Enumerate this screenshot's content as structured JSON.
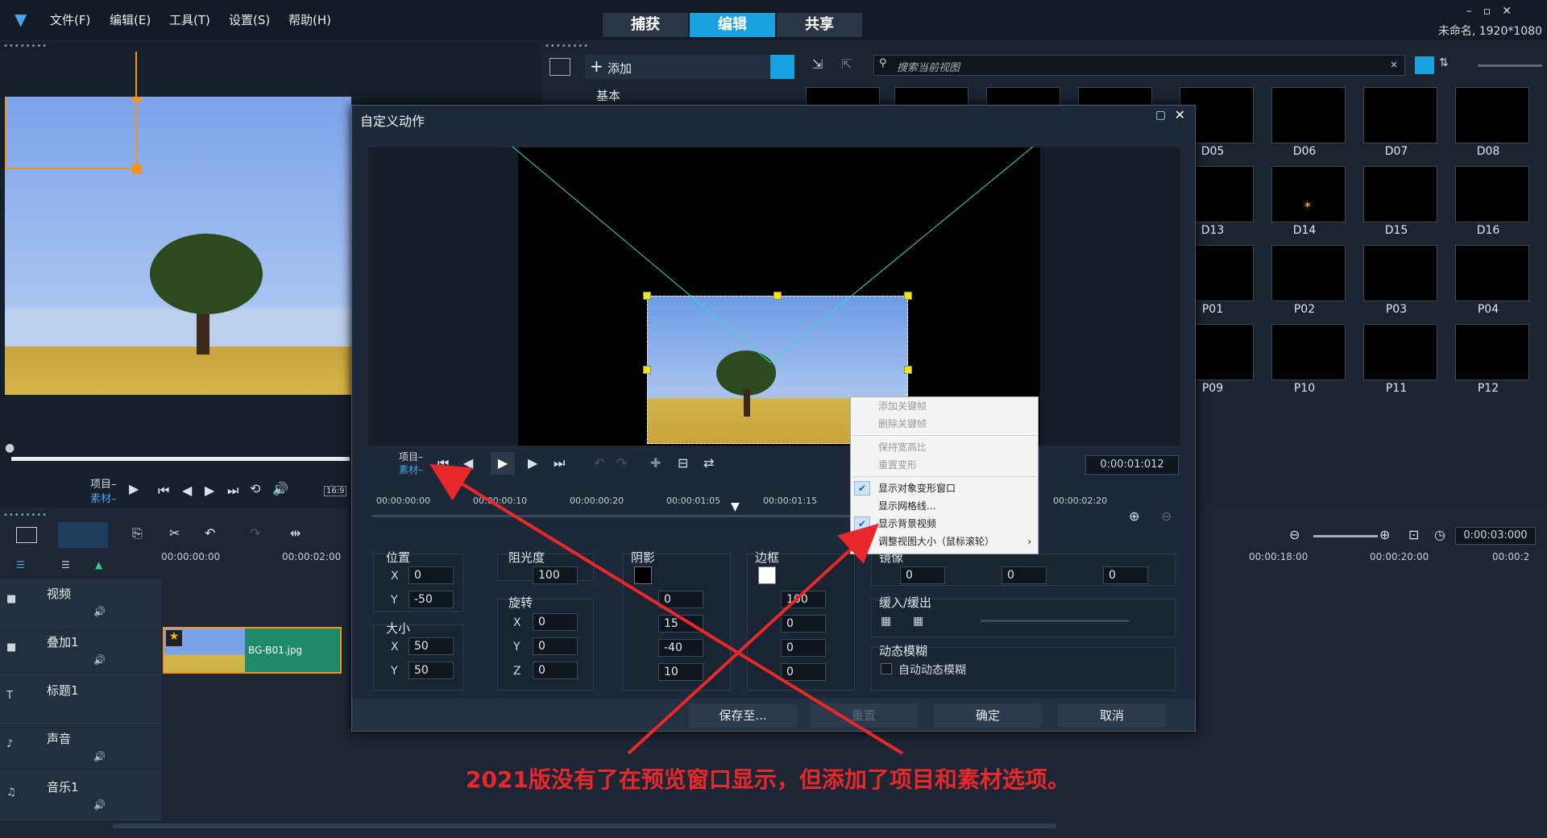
{
  "menu": [
    "文件(F)",
    "编辑(E)",
    "工具(T)",
    "设置(S)",
    "帮助(H)"
  ],
  "main_tabs": [
    "捕获",
    "编辑",
    "共享"
  ],
  "project_name": "未命名, 1920*1080",
  "preview": {
    "proj_label": "项目",
    "clip_label": "素材",
    "aspect": "16:9"
  },
  "library": {
    "add_label": "添加",
    "basic_label": "基本",
    "search_placeholder": "搜索当前视图",
    "thumbs": [
      {
        "row": 0,
        "items": [
          "",
          "",
          "",
          "",
          "D05",
          "D06",
          "D07",
          "D08"
        ]
      },
      {
        "row": 1,
        "items": [
          "D13",
          "D14",
          "D15",
          "D16"
        ]
      },
      {
        "row": 2,
        "items": [
          "P01",
          "P02",
          "P03",
          "P04"
        ]
      },
      {
        "row": 3,
        "items": [
          "P09",
          "P10",
          "P11",
          "P12"
        ]
      }
    ]
  },
  "timeline": {
    "ruler": [
      "00:00:00:00",
      "00:00:02:00",
      "00:00:18:00",
      "00:00:20:00",
      "00:00:2"
    ],
    "duration": "0:00:03:000",
    "tracks": [
      "视频",
      "叠加1",
      "标题1",
      "声音",
      "音乐1"
    ],
    "clip_name": "BG-B01.jpg"
  },
  "dialog": {
    "title": "自定义动作",
    "proj_label": "项目",
    "clip_label": "素材",
    "timecode": "0:00:01:012",
    "ruler": [
      "00:00:00:00",
      "00:00:00:10",
      "00:00:00:20",
      "00:00:01:05",
      "00:00:01:15",
      "00:00:02:20"
    ],
    "position": {
      "label": "位置",
      "x": "0",
      "y": "-50"
    },
    "size": {
      "label": "大小",
      "x": "50",
      "y": "50"
    },
    "opacity": {
      "label": "阻光度",
      "value": "100"
    },
    "rotation": {
      "label": "旋转",
      "x": "0",
      "y": "0",
      "z": "0"
    },
    "shadow": {
      "label": "阴影",
      "v1": "0",
      "v2": "15",
      "v3": "-40",
      "v4": "10"
    },
    "border": {
      "label": "边框",
      "v1": "100",
      "v2": "0",
      "v3": "0",
      "v4": "0"
    },
    "mirror": {
      "label": "镜像",
      "v1": "0",
      "v2": "0",
      "v3": "0"
    },
    "ease": {
      "label": "缓入/缓出"
    },
    "motion_blur": {
      "label": "动态模糊",
      "checkbox": "自动动态模糊"
    },
    "buttons": {
      "save": "保存至...",
      "reset": "重置",
      "ok": "确定",
      "cancel": "取消"
    }
  },
  "context_menu": {
    "items": [
      {
        "label": "添加关键帧",
        "disabled": true,
        "checked": false
      },
      {
        "label": "删除关键帧",
        "disabled": true,
        "checked": false
      },
      {
        "label": "保持宽高比",
        "disabled": true,
        "checked": false
      },
      {
        "label": "重置变形",
        "disabled": true,
        "checked": false
      },
      {
        "label": "显示对象变形窗口",
        "disabled": false,
        "checked": true
      },
      {
        "label": "显示网格线...",
        "disabled": false,
        "checked": false
      },
      {
        "label": "显示背景视频",
        "disabled": false,
        "checked": true
      },
      {
        "label": "调整视图大小（鼠标滚轮）",
        "disabled": false,
        "checked": false
      }
    ]
  },
  "annotation": "2021版没有了在预览窗口显示，但添加了项目和素材选项。",
  "colors": {
    "accent": "#1aa1e0",
    "annotation": "#e8282a",
    "clip": "#1e8a6a"
  }
}
